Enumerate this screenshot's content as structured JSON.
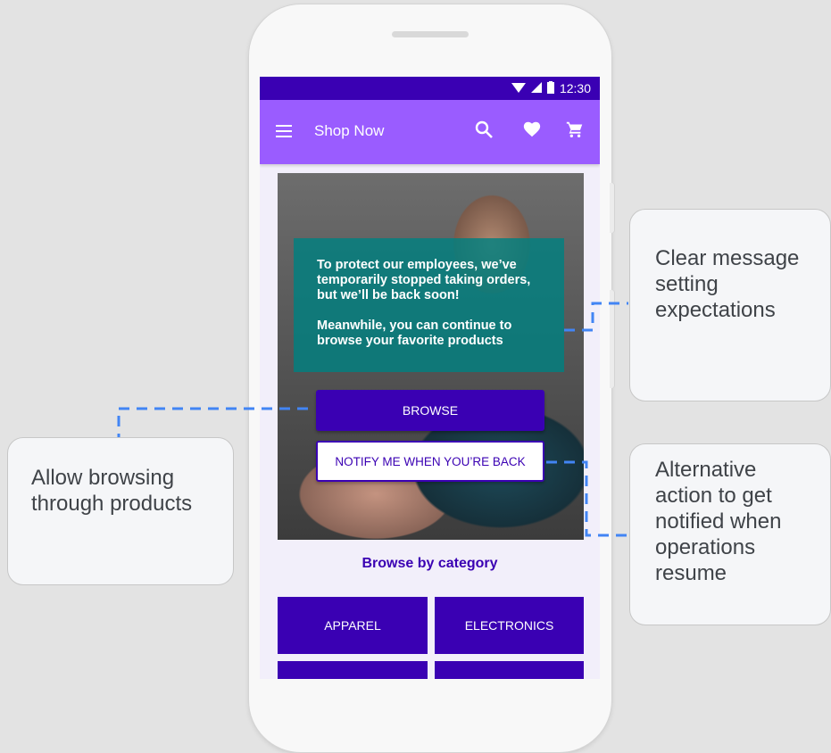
{
  "status_bar": {
    "time": "12:30"
  },
  "app_bar": {
    "title": "Shop Now",
    "icons": [
      "menu-icon",
      "search-icon",
      "heart-icon",
      "cart-icon"
    ]
  },
  "hero": {
    "message_line1": "To protect our employees, we’ve temporarily stopped taking orders, but we’ll be back soon!",
    "message_line2": "Meanwhile, you can continue to browse your favorite products",
    "browse_label": "BROWSE",
    "notify_label": "NOTIFY ME WHEN YOU’RE BACK"
  },
  "category_section": {
    "title": "Browse by category",
    "categories": [
      "APPAREL",
      "ELECTRONICS",
      "",
      ""
    ]
  },
  "callouts": {
    "message": "Clear message setting expectations",
    "browse": "Allow browsing through products",
    "notify": "Alternative action to get notified when operations resume"
  },
  "colors": {
    "primary": "#3a00b3",
    "app_bar": "#9a5cff",
    "message_box": "#008080",
    "connector": "#4285f4"
  }
}
